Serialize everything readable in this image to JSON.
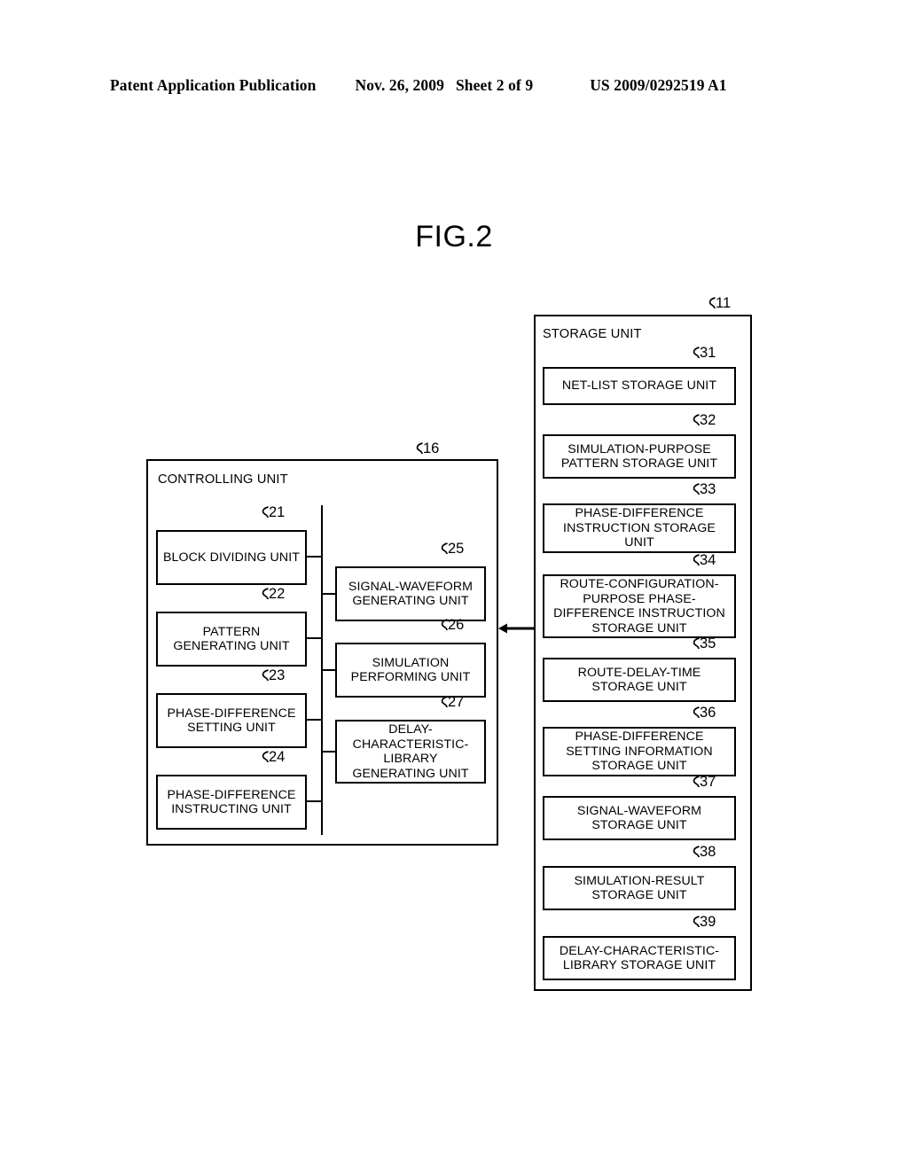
{
  "header": {
    "publication": "Patent Application Publication",
    "date": "Nov. 26, 2009",
    "sheet": "Sheet 2 of 9",
    "patent_number": "US 2009/0292519 A1"
  },
  "figure": {
    "title": "FIG.2"
  },
  "diagram": {
    "controlling_unit": {
      "ref": "16",
      "title": "CONTROLLING UNIT",
      "left_column": [
        {
          "ref": "21",
          "label": "BLOCK DIVIDING UNIT"
        },
        {
          "ref": "22",
          "label": "PATTERN GENERATING UNIT"
        },
        {
          "ref": "23",
          "label": "PHASE-DIFFERENCE SETTING UNIT"
        },
        {
          "ref": "24",
          "label": "PHASE-DIFFERENCE INSTRUCTING UNIT"
        }
      ],
      "right_column": [
        {
          "ref": "25",
          "label": "SIGNAL-WAVEFORM GENERATING UNIT"
        },
        {
          "ref": "26",
          "label": "SIMULATION PERFORMING UNIT"
        },
        {
          "ref": "27",
          "label": "DELAY-CHARACTERISTIC-LIBRARY GENERATING UNIT"
        }
      ]
    },
    "storage_unit": {
      "ref": "11",
      "title": "STORAGE UNIT",
      "items": [
        {
          "ref": "31",
          "label": "NET-LIST STORAGE UNIT"
        },
        {
          "ref": "32",
          "label": "SIMULATION-PURPOSE PATTERN STORAGE UNIT"
        },
        {
          "ref": "33",
          "label": "PHASE-DIFFERENCE INSTRUCTION STORAGE UNIT"
        },
        {
          "ref": "34",
          "label": "ROUTE-CONFIGURATION-PURPOSE PHASE-DIFFERENCE INSTRUCTION STORAGE UNIT"
        },
        {
          "ref": "35",
          "label": "ROUTE-DELAY-TIME STORAGE UNIT"
        },
        {
          "ref": "36",
          "label": "PHASE-DIFFERENCE SETTING INFORMATION STORAGE UNIT"
        },
        {
          "ref": "37",
          "label": "SIGNAL-WAVEFORM STORAGE UNIT"
        },
        {
          "ref": "38",
          "label": "SIMULATION-RESULT STORAGE UNIT"
        },
        {
          "ref": "39",
          "label": "DELAY-CHARACTERISTIC-LIBRARY STORAGE UNIT"
        }
      ]
    },
    "connector": {
      "name": "bidirectional-arrow"
    }
  }
}
